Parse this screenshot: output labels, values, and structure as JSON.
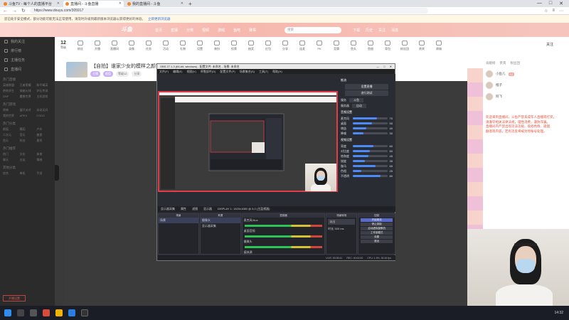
{
  "browser": {
    "tabs": [
      {
        "title": "斗鱼TV - 每个人的直播平台",
        "active": false
      },
      {
        "title": "直播间 - 斗鱼直播",
        "active": true
      },
      {
        "title": "我的直播间 - 斗鱼",
        "active": false
      }
    ],
    "url": "https://www.douyu.com/305917",
    "window_controls": [
      "—",
      "□",
      "✕"
    ],
    "nav_icons": [
      "←",
      "→",
      "↻"
    ],
    "addr_right_icons": [
      "☆",
      "≡",
      "⋯"
    ]
  },
  "notice": {
    "text": "您已处于安全模式，部分功能可能无法正常使用，请及时升级到最新版本浏览器以获得更好的体验。",
    "link": "立即更新浏览器"
  },
  "site": {
    "logo": "斗鱼",
    "nav": [
      "首页",
      "直播",
      "分类",
      "视频",
      "游戏",
      "鱼吧",
      "赛事"
    ],
    "search_placeholder": "搜索",
    "right_items": [
      "下载",
      "历史",
      "关注",
      "消息"
    ],
    "accent": "#f58220"
  },
  "sidebar": {
    "items": [
      "我的关注",
      "排行榜",
      "主播任务",
      "直播间"
    ],
    "sections": [
      {
        "title": "热门直播",
        "entries": [
          "英雄联盟",
          "王者荣耀",
          "和平精英",
          "绝地求生",
          "穿越火线",
          "炉石传说",
          "DNF",
          "魔兽世界",
          "主机游戏"
        ]
      },
      {
        "title": "热门游戏",
        "entries": [
          "原神",
          "蛋仔派对",
          "永劫无间",
          "我的世界",
          "APEX",
          "CSGO"
        ]
      },
      {
        "title": "热门分类",
        "entries": [
          "颜值",
          "舞蹈",
          "户外",
          "二次元",
          "音乐",
          "美食",
          "鱼乐",
          "科技",
          "星秀"
        ]
      },
      {
        "title": "热门推荐",
        "entries": [
          "热门",
          "文化",
          "体育",
          "聊天",
          "交友",
          "情感"
        ]
      },
      {
        "title": "其他分类",
        "entries": [
          "综合",
          "单机",
          "手游"
        ]
      }
    ],
    "bottom_button": "开播设置"
  },
  "toolstrip": {
    "level_num": "12",
    "tools": [
      "等级",
      "粉丝",
      "开播",
      "直播间",
      "录像",
      "任务",
      "活动",
      "礼物",
      "设置",
      "装扮",
      "投票",
      "抽奖",
      "红包",
      "分享",
      "连麦",
      "PK",
      "竞猜",
      "鱼丸",
      "鱼翅",
      "背包",
      "粉丝团",
      "贵宾",
      "商城"
    ],
    "fav_label": "关注"
  },
  "stream": {
    "title": "【自拍】谁家少女的模样之颜？",
    "chips": [
      "主播",
      "颜值",
      "等级12",
      "分享"
    ]
  },
  "right_panel": {
    "tabs": [
      "贡献榜",
      "贵宾",
      "粉丝团"
    ],
    "viewers": [
      "小鱼儿",
      "橙子",
      "阿飞"
    ],
    "badge": "12",
    "chat_lines": [
      "欢迎来到直播间，斗鱼严禁未成年人直播或打赏，",
      "请遵守相关法律法规，理性消费，谨防诈骗。",
      "直播间内严禁出现违法违规、低俗色情、吸烟",
      "酗酒等内容，若有违反将被封停账号处理。"
    ]
  },
  "obs": {
    "title": "OBS 27.1.3 (64-bit, windows) - 配置文件: 未命名 - 场景: 未命名",
    "menu": [
      "文件(F)",
      "编辑(E)",
      "视图(V)",
      "停靠部件(D)",
      "配置文件(P)",
      "场景集合(S)",
      "工具(T)",
      "帮助(H)"
    ],
    "side": {
      "header": "推流",
      "buttons": [
        "设置直播",
        "进行测试"
      ],
      "fields": [
        {
          "label": "服务",
          "value": "斗鱼"
        },
        {
          "label": "服务器",
          "value": "自动"
        }
      ],
      "section_audio": "音频设置",
      "sliders": [
        {
          "label": "麦克风",
          "value": 70
        },
        {
          "label": "桌面",
          "value": 55
        },
        {
          "label": "增益",
          "value": 40
        },
        {
          "label": "降噪",
          "value": 30
        }
      ],
      "section_video": "视频设置",
      "sliders2": [
        {
          "label": "亮度",
          "value": 60
        },
        {
          "label": "对比度",
          "value": 50
        },
        {
          "label": "饱和度",
          "value": 45
        },
        {
          "label": "锐度",
          "value": 35
        },
        {
          "label": "伽马",
          "value": 65
        },
        {
          "label": "色相",
          "value": 25
        },
        {
          "label": "不透明",
          "value": 80
        }
      ]
    },
    "ctrlbar": [
      "显示器采集",
      "属性",
      "滤镜",
      "显示器",
      "DISPLAY 1: 1920x1080 @ 0,0 (主监视器)"
    ],
    "docks": {
      "scenes": {
        "title": "场景",
        "items": [
          "场景"
        ]
      },
      "sources": {
        "title": "来源",
        "items": [
          "摄像头",
          "显示器采集"
        ]
      },
      "mixer": {
        "title": "混音器",
        "channels": [
          "麦克风/Aux",
          "桌面音频",
          "摄像头",
          "媒体源"
        ]
      },
      "transitions": {
        "title": "场景转场",
        "type": "淡出",
        "duration_label": "时长",
        "duration": "300 ms"
      },
      "controls": {
        "title": "控制",
        "buttons": [
          "开始推流",
          "停止录制",
          "启动虚拟摄像机",
          "工作室模式",
          "设置",
          "退出"
        ]
      }
    },
    "status": [
      "LIVE: 00:05:41",
      "REC: 00:00:00",
      "CPU: 1.9%, 30.00 fps"
    ]
  },
  "taskbar": {
    "time": "14:32"
  }
}
